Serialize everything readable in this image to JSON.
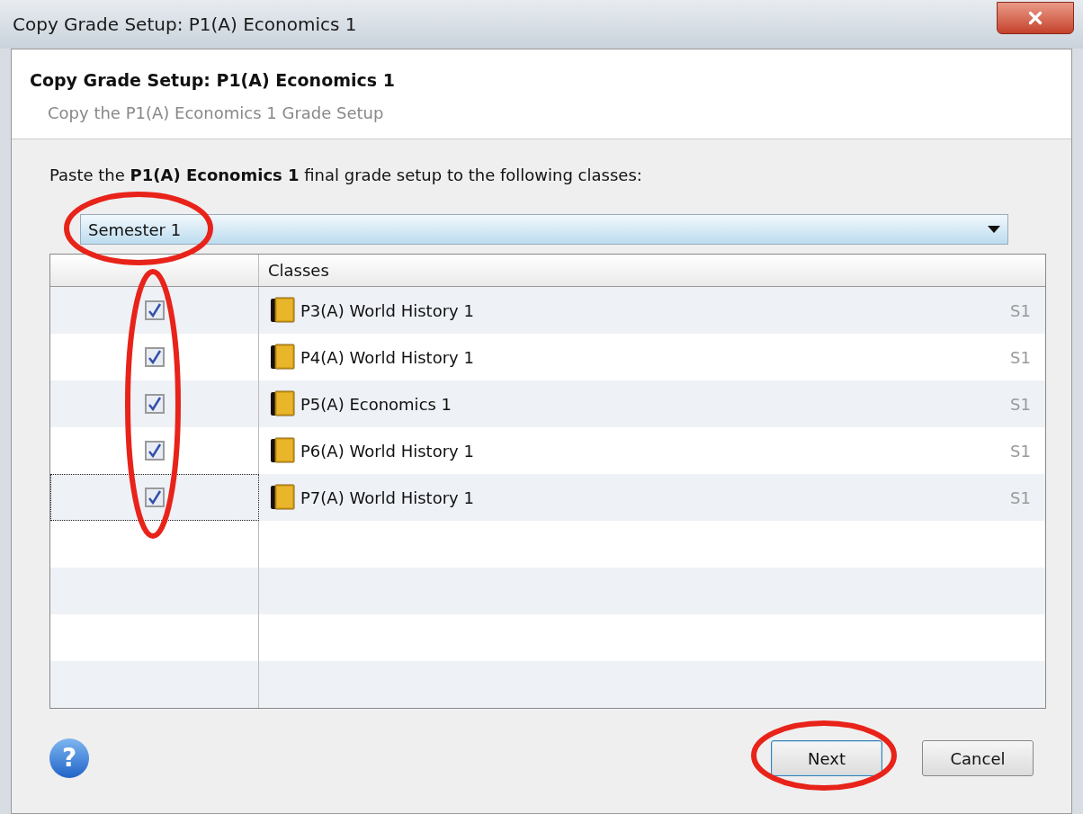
{
  "window": {
    "title": "Copy Grade Setup: P1(A) Economics 1"
  },
  "header": {
    "title": "Copy Grade Setup: P1(A) Economics 1",
    "subtitle": "Copy the P1(A) Economics 1 Grade Setup"
  },
  "instruction": "Paste the **P1(A) Economics 1** final grade setup to the following classes:",
  "term_select": {
    "value": "Semester 1"
  },
  "table": {
    "columns": [
      "Classes"
    ],
    "rows": [
      {
        "checked": true,
        "focused": false,
        "name": "P3(A) World History 1",
        "term": "S1"
      },
      {
        "checked": true,
        "focused": false,
        "name": "P4(A) World History 1",
        "term": "S1"
      },
      {
        "checked": true,
        "focused": false,
        "name": "P5(A) Economics 1",
        "term": "S1"
      },
      {
        "checked": true,
        "focused": false,
        "name": "P6(A) World History 1",
        "term": "S1"
      },
      {
        "checked": true,
        "focused": true,
        "name": "P7(A) World History 1",
        "term": "S1"
      }
    ]
  },
  "help": {
    "glyph": "?"
  },
  "buttons": [
    {
      "label": "Next",
      "kind": "primary"
    },
    {
      "label": "Cancel",
      "kind": "secondary"
    }
  ]
}
